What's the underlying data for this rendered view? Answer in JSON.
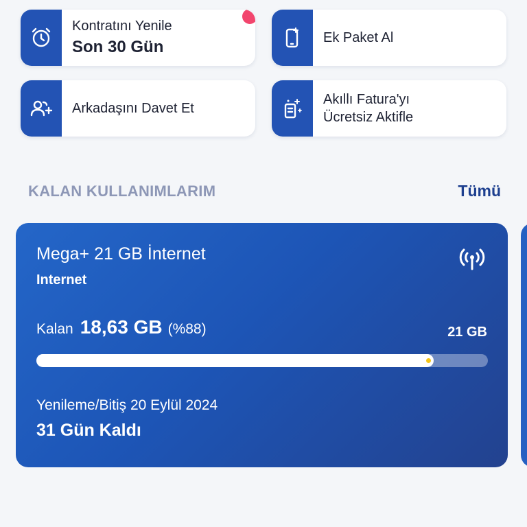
{
  "quick_actions": [
    {
      "title": "Kontratını Yenile",
      "subtitle": "Son 30 Gün",
      "icon": "alarm-clock-icon",
      "has_badge": true
    },
    {
      "title": "Ek Paket Al",
      "icon": "phone-sparkle-icon"
    },
    {
      "title": "Arkadaşını Davet Et",
      "icon": "add-user-icon"
    },
    {
      "title_line1": "Akıllı Fatura'yı",
      "title_line2": "Ücretsiz Aktifle",
      "icon": "smart-bill-icon"
    }
  ],
  "section": {
    "title": "KALAN KULLANIMLARIM",
    "see_all": "Tümü"
  },
  "usage_card": {
    "package_name": "Mega+ 21 GB İnternet",
    "type": "Internet",
    "remaining_label": "Kalan",
    "remaining_value": "18,63 GB",
    "remaining_percent_text": "(%88)",
    "remaining_fraction": 0.88,
    "total": "21 GB",
    "renew_label": "Yenileme/Bitiş 20 Eylül 2024",
    "days_left": "31 Gün Kaldı",
    "icon": "signal-tower-icon"
  },
  "colors": {
    "accent": "#2353b4",
    "badge": "#f2456d",
    "section_title": "#8d97b6",
    "link": "#1d3f8f",
    "progress_marker": "#f5c518"
  }
}
